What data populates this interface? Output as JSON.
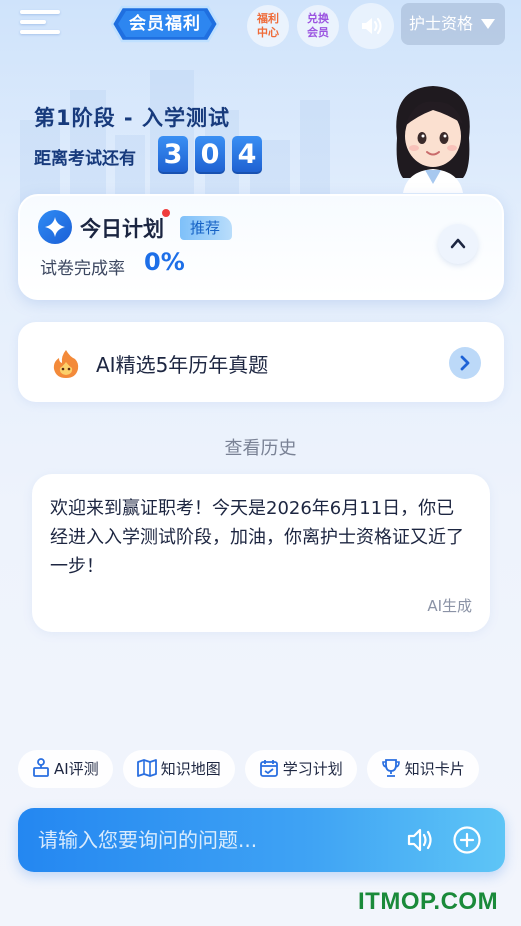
{
  "header": {
    "member_label": "会员福利",
    "welfare_label_line1": "福利",
    "welfare_label_line2": "中心",
    "exchange_label_line1": "兑换",
    "exchange_label_line2": "会员",
    "exam_select": "护士资格"
  },
  "stage": {
    "title": "第1阶段 - 入学测试",
    "countdown_label": "距离考试还有",
    "digits": [
      "3",
      "0",
      "4"
    ]
  },
  "plan": {
    "title": "今日计划",
    "badge": "推荐",
    "rate_label": "试卷完成率",
    "rate_value": "0%"
  },
  "ai_card": {
    "label": "AI精选5年历年真题"
  },
  "history_label": "查看历史",
  "message": {
    "text": "欢迎来到赢证职考！今天是2026年6月11日，你已经进入入学测试阶段，加油，你离护士资格证又近了一步！",
    "footer": "AI生成"
  },
  "chips": [
    "AI评测",
    "知识地图",
    "学习计划",
    "知识卡片"
  ],
  "input": {
    "placeholder": "请输入您要询问的问题..."
  },
  "watermark": "ITMOP.COM",
  "colors": {
    "accent": "#1d6fe8",
    "stage_text": "#173a7c",
    "watermark": "#1a8a3a"
  }
}
